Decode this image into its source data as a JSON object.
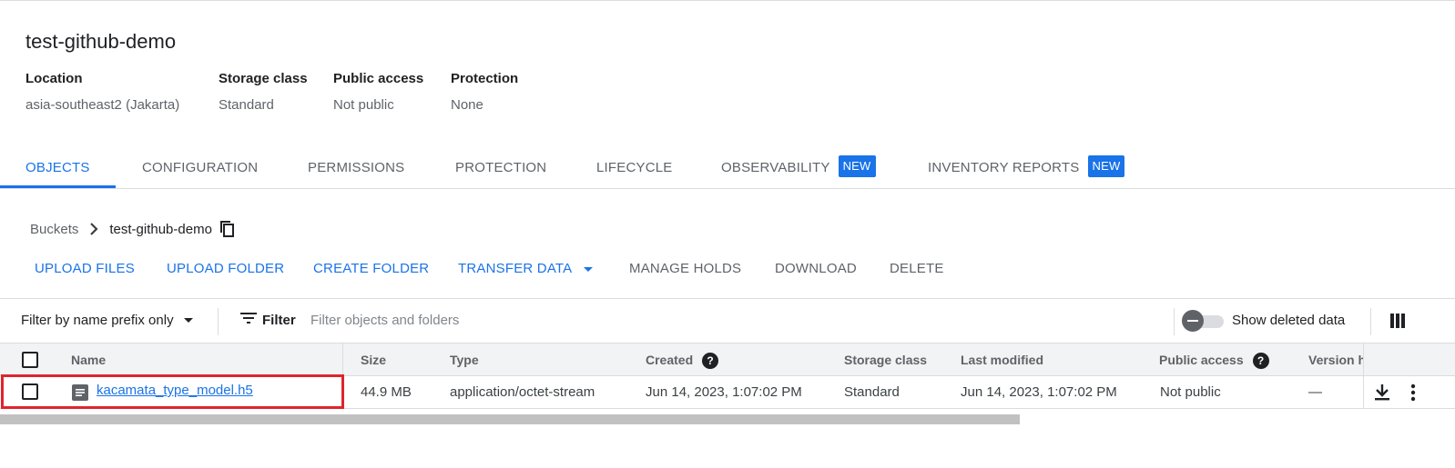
{
  "bucket": {
    "title": "test-github-demo",
    "meta": [
      {
        "label": "Location",
        "value": "asia-southeast2 (Jakarta)"
      },
      {
        "label": "Storage class",
        "value": "Standard"
      },
      {
        "label": "Public access",
        "value": "Not public"
      },
      {
        "label": "Protection",
        "value": "None"
      }
    ]
  },
  "tabs": [
    {
      "label": "OBJECTS",
      "active": true
    },
    {
      "label": "CONFIGURATION"
    },
    {
      "label": "PERMISSIONS"
    },
    {
      "label": "PROTECTION"
    },
    {
      "label": "LIFECYCLE"
    },
    {
      "label": "OBSERVABILITY",
      "badge": "NEW"
    },
    {
      "label": "INVENTORY REPORTS",
      "badge": "NEW"
    }
  ],
  "breadcrumb": {
    "root": "Buckets",
    "current": "test-github-demo"
  },
  "actions": {
    "upload_files": "UPLOAD FILES",
    "upload_folder": "UPLOAD FOLDER",
    "create_folder": "CREATE FOLDER",
    "transfer_data": "TRANSFER DATA",
    "manage_holds": "MANAGE HOLDS",
    "download": "DOWNLOAD",
    "delete": "DELETE"
  },
  "filter": {
    "mode": "Filter by name prefix only",
    "label": "Filter",
    "placeholder": "Filter objects and folders",
    "show_deleted": "Show deleted data"
  },
  "table": {
    "columns": {
      "name": "Name",
      "size": "Size",
      "type": "Type",
      "created": "Created",
      "storage_class": "Storage class",
      "last_modified": "Last modified",
      "public_access": "Public access",
      "version": "Version h"
    },
    "rows": [
      {
        "name": "kacamata_type_model.h5",
        "size": "44.9 MB",
        "type": "application/octet-stream",
        "created": "Jun 14, 2023, 1:07:02 PM",
        "storage_class": "Standard",
        "last_modified": "Jun 14, 2023, 1:07:02 PM",
        "public_access": "Not public",
        "version": "—"
      }
    ]
  },
  "colors": {
    "accent": "#1a73e8",
    "highlight": "#e0242c"
  }
}
